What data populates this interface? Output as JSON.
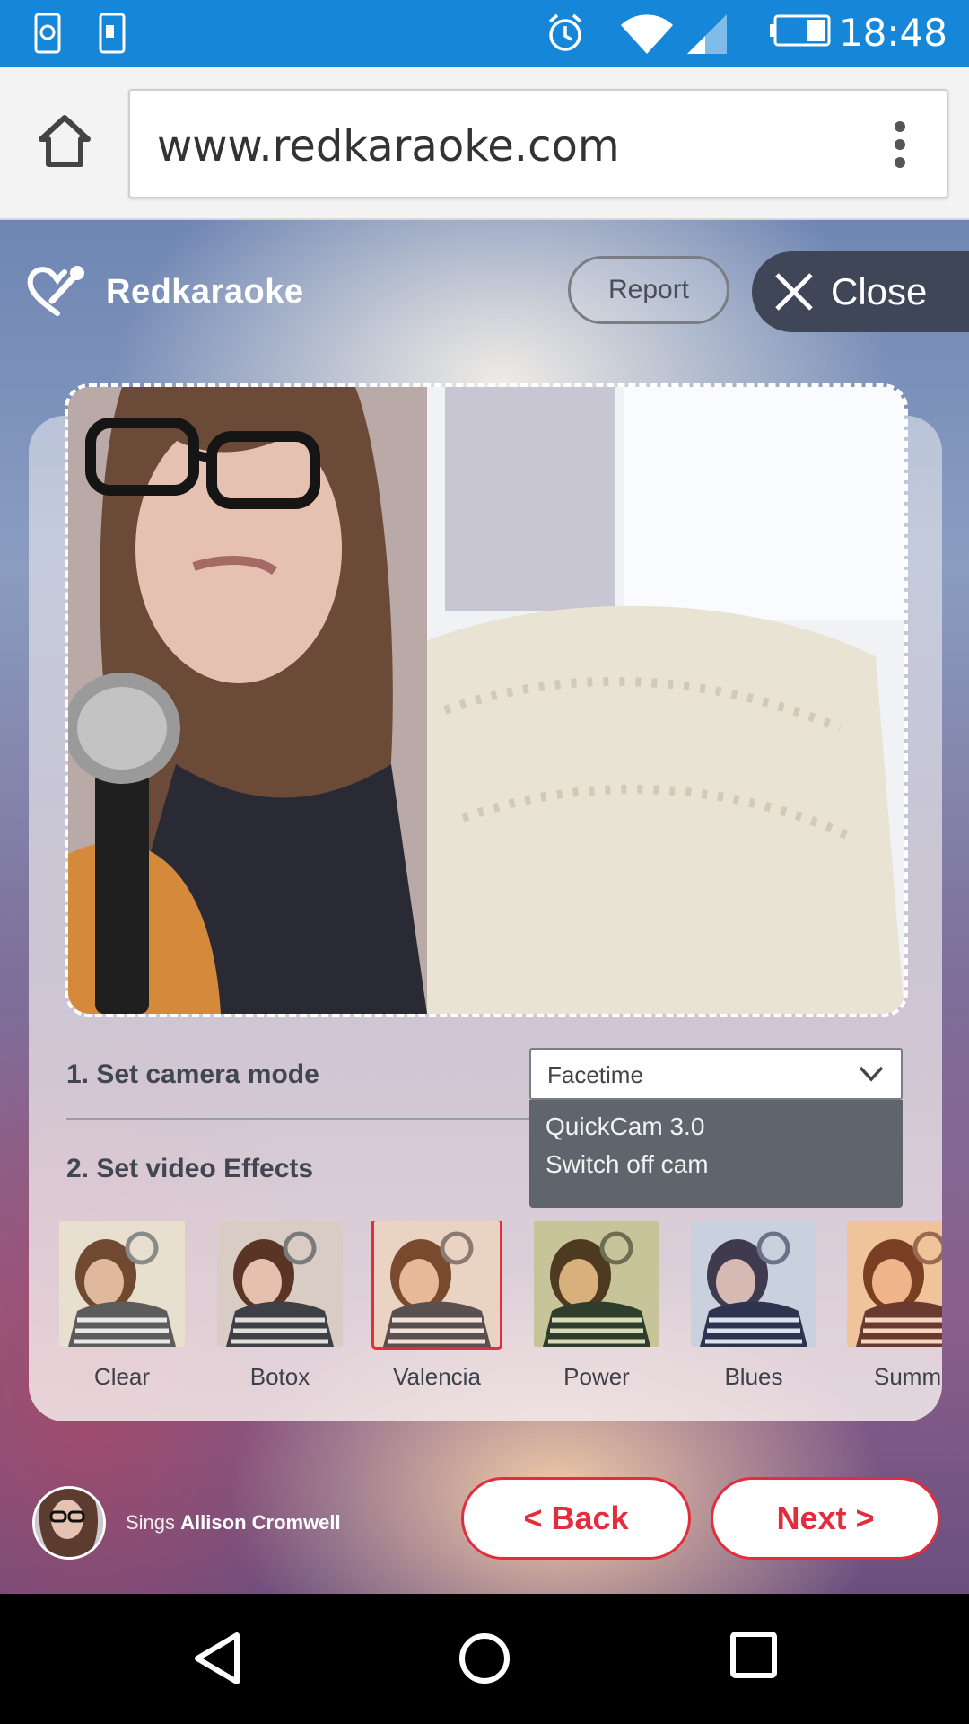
{
  "status_bar": {
    "time": "18:48",
    "icons": [
      "sync-icon",
      "screenshot-icon",
      "alarm-icon",
      "wifi-icon",
      "signal-icon",
      "battery-icon"
    ]
  },
  "browser": {
    "url": "www.redkaraoke.com",
    "icons": [
      "home-icon",
      "overflow-menu-icon"
    ]
  },
  "header": {
    "brand": "Redkaraoke",
    "report_label": "Report",
    "close_label": "Close"
  },
  "camera": {
    "step_label": "1. Set camera mode",
    "selected": "Facetime",
    "options": [
      "QuickCam 3.0",
      "Switch off cam"
    ]
  },
  "effects": {
    "step_label": "2. Set video Effects",
    "items": [
      {
        "label": "Clear"
      },
      {
        "label": "Botox"
      },
      {
        "label": "Valencia",
        "selected": true
      },
      {
        "label": "Power"
      },
      {
        "label": "Blues"
      },
      {
        "label": "Summe"
      }
    ]
  },
  "singer": {
    "prefix": "Sings",
    "name": "Allison Cromwell"
  },
  "nav": {
    "back_label": "< Back",
    "next_label": "Next >"
  },
  "colors": {
    "status_bar": "#1686d9",
    "accent_red": "#e32c3c",
    "close_button": "#3e4658",
    "dropdown_bg": "#5f656c"
  }
}
